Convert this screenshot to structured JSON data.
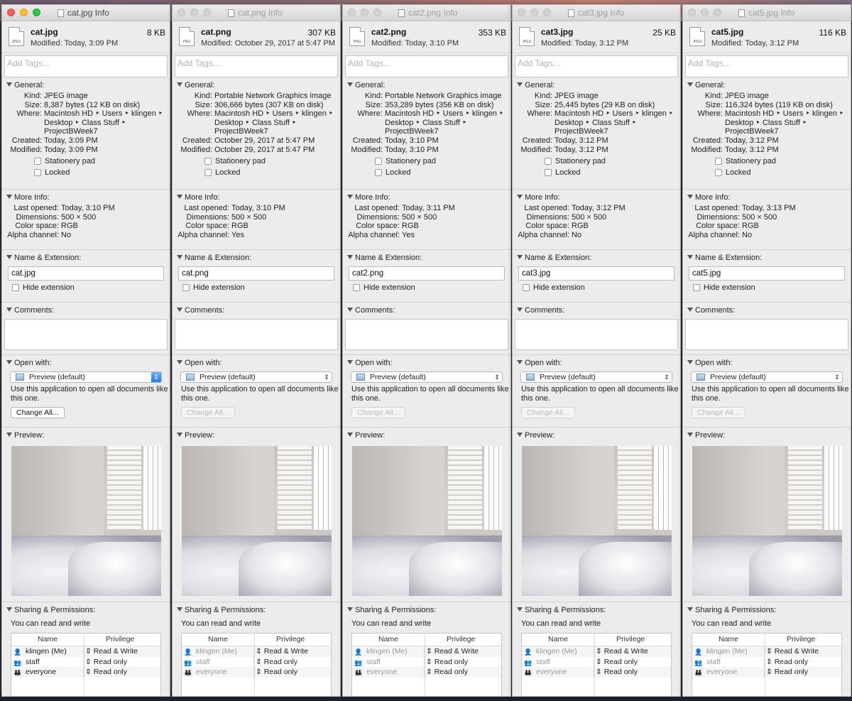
{
  "section_labels": {
    "general": "General:",
    "more_info": "More Info:",
    "name_ext": "Name & Extension:",
    "comments": "Comments:",
    "open_with": "Open with:",
    "preview": "Preview:",
    "sharing": "Sharing & Permissions:"
  },
  "field_labels": {
    "kind": "Kind:",
    "size": "Size:",
    "where": "Where:",
    "created": "Created:",
    "modified": "Modified:",
    "last_opened": "Last opened:",
    "dimensions": "Dimensions:",
    "color_space": "Color space:",
    "alpha_channel": "Alpha channel:"
  },
  "common": {
    "tags_placeholder": "Add Tags...",
    "stationery": "Stationery pad",
    "locked": "Locked",
    "hide_extension": "Hide extension",
    "open_with_app": "Preview (default)",
    "open_with_note": "Use this application to open all documents like this one.",
    "change_all": "Change All...",
    "can_read_write": "You can read and write",
    "col_name": "Name",
    "col_privilege": "Privilege",
    "where_line1": "Macintosh HD ‣ Users ‣ klingen ‣",
    "where_line2": "Desktop ‣ Class Stuff ‣",
    "where_line3": "ProjectBWeek7",
    "permissions": [
      {
        "name": "klingen (Me)",
        "privilege": "Read & Write",
        "icon": "user-icon"
      },
      {
        "name": "staff",
        "privilege": "Read only",
        "icon": "group-icon"
      },
      {
        "name": "everyone",
        "privilege": "Read only",
        "icon": "everyone-icon"
      }
    ]
  },
  "windows": [
    {
      "title": "cat.jpg Info",
      "name": "cat.jpg",
      "short_size": "8 KB",
      "icon_label": "JPEG",
      "modified_header": "Modified: Today, 3:09 PM",
      "kind": "JPEG image",
      "size": "8,387 bytes (12 KB on disk)",
      "created": "Today, 3:09 PM",
      "modified": "Today, 3:09 PM",
      "last_opened": "Today, 3:10 PM",
      "dimensions": "500 × 500",
      "color_space": "RGB",
      "alpha": "No",
      "filename": "cat.jpg"
    },
    {
      "title": "cat.png Info",
      "name": "cat.png",
      "short_size": "307 KB",
      "icon_label": "PNG",
      "modified_header": "Modified: October 29, 2017 at 5:47 PM",
      "kind": "Portable Network Graphics image",
      "size": "306,666 bytes (307 KB on disk)",
      "created": "October 29, 2017 at 5:47 PM",
      "modified": "October 29, 2017 at 5:47 PM",
      "last_opened": "Today, 3:10 PM",
      "dimensions": "500 × 500",
      "color_space": "RGB",
      "alpha": "Yes",
      "filename": "cat.png"
    },
    {
      "title": "cat2.png Info",
      "name": "cat2.png",
      "short_size": "353 KB",
      "icon_label": "PNG",
      "modified_header": "Modified: Today, 3:10 PM",
      "kind": "Portable Network Graphics image",
      "size": "353,289 bytes (356 KB on disk)",
      "created": "Today, 3:10 PM",
      "modified": "Today, 3:10 PM",
      "last_opened": "Today, 3:11 PM",
      "dimensions": "500 × 500",
      "color_space": "RGB",
      "alpha": "Yes",
      "filename": "cat2.png"
    },
    {
      "title": "cat3.jpg Info",
      "name": "cat3.jpg",
      "short_size": "25 KB",
      "icon_label": "JPEG",
      "modified_header": "Modified: Today, 3:12 PM",
      "kind": "JPEG image",
      "size": "25,445 bytes (29 KB on disk)",
      "created": "Today, 3:12 PM",
      "modified": "Today, 3:12 PM",
      "last_opened": "Today, 3:12 PM",
      "dimensions": "500 × 500",
      "color_space": "RGB",
      "alpha": "No",
      "filename": "cat3.jpg"
    },
    {
      "title": "cat5.jpg Info",
      "name": "cat5.jpg",
      "short_size": "116 KB",
      "icon_label": "JPEG",
      "modified_header": "Modified: Today, 3:12 PM",
      "kind": "JPEG image",
      "size": "116,324 bytes (119 KB on disk)",
      "created": "Today, 3:12 PM",
      "modified": "Today, 3:12 PM",
      "last_opened": "Today, 3:13 PM",
      "dimensions": "500 × 500",
      "color_space": "RGB",
      "alpha": "No",
      "filename": "cat5.jpg"
    }
  ]
}
